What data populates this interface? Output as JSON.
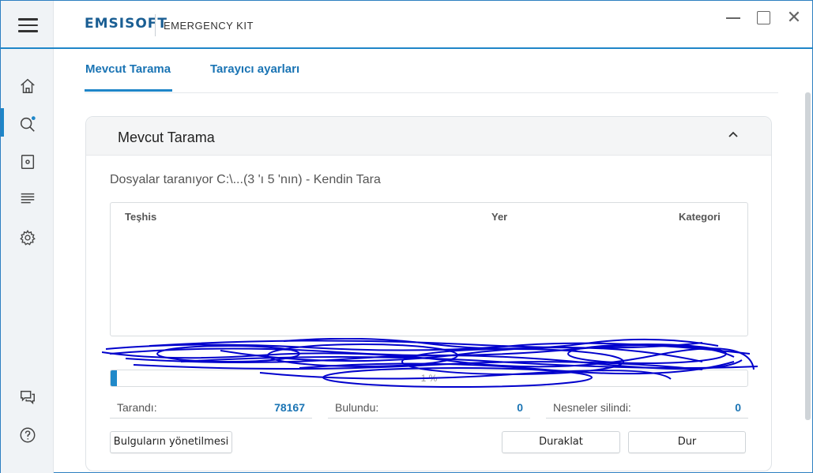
{
  "header": {
    "logo": "EMSISOFT",
    "product": "EMERGENCY KIT"
  },
  "window_controls": {
    "close_glyph": "✕"
  },
  "sidebar": {
    "items": [
      {
        "name": "home",
        "icon": "home-icon"
      },
      {
        "name": "scan",
        "icon": "search-icon",
        "active": true
      },
      {
        "name": "quarantine",
        "icon": "quarantine-icon"
      },
      {
        "name": "logs",
        "icon": "logs-icon"
      },
      {
        "name": "settings",
        "icon": "gear-icon"
      },
      {
        "name": "feedback",
        "icon": "chat-icon"
      },
      {
        "name": "help",
        "icon": "help-icon"
      }
    ]
  },
  "tabs": [
    {
      "label": "Mevcut Tarama",
      "active": true
    },
    {
      "label": "Tarayıcı ayarları"
    }
  ],
  "panel": {
    "title": "Mevcut Tarama",
    "status": "Dosyalar taranıyor C:\\...(3 'ı 5 'nın) - Kendin Tara",
    "columns": [
      "Teşhis",
      "Yer",
      "Kategori"
    ],
    "progress": {
      "fraction": 0.01,
      "text": "1 %"
    },
    "stats": {
      "scanned_label": "Tarandı:",
      "scanned_value": "78167",
      "found_label": "Bulundu:",
      "found_value": "0",
      "removed_label": "Nesneler silindi:",
      "removed_value": "0"
    },
    "buttons": {
      "manage": "Bulguların yönetilmesi",
      "pause": "Duraklat",
      "stop": "Dur"
    }
  },
  "colors": {
    "accent": "#1f86c8",
    "link": "#1a74b4",
    "scribble": "#0000cc"
  }
}
